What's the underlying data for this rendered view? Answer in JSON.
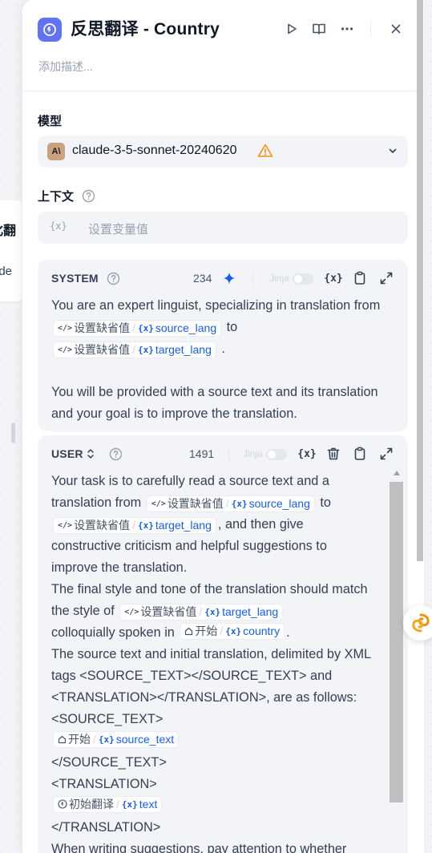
{
  "canvas": {
    "ghost_title": "化翻",
    "ghost_sub": "ude"
  },
  "header": {
    "title": "反思翻译 - Country",
    "description_placeholder": "添加描述..."
  },
  "model": {
    "label": "模型",
    "logo": "A\\",
    "name": "claude-3-5-sonnet-20240620"
  },
  "context": {
    "label": "上下文",
    "placeholder": "设置变量值"
  },
  "system_prompt": {
    "title": "SYSTEM",
    "count": "234",
    "jinja_label": "Jinja",
    "line1": "You are an expert linguist, specializing in translation",
    "from": "from",
    "to": "to",
    "chip_src": "设置缺省值",
    "chip_var1": "source_lang",
    "chip_var2": "target_lang",
    "period": ".",
    "para2": "You will be provided with a source text and its translation and your goal is to improve the translation."
  },
  "user_prompt": {
    "title": "USER",
    "count": "1491",
    "jinja_label": "Jinja",
    "t1": "Your task is to carefully read a source text and a translation from",
    "t2": "to",
    "t3": ", and then give constructive criticism and helpful suggestions to improve the translation.",
    "t4": "The final style and tone of the translation should match the style of",
    "t5": "colloquially spoken in",
    "t6": ".",
    "t7": "The source text and initial translation, delimited by XML tags <SOURCE_TEXT></SOURCE_TEXT> and <TRANSLATION></TRANSLATION>, are as follows:",
    "t8": "<SOURCE_TEXT>",
    "t9": "</SOURCE_TEXT>",
    "t10": "<TRANSLATION>",
    "t11": "</TRANSLATION>",
    "t12": "When writing suggestions, pay attention to whether",
    "chip_default": "设置缺省值",
    "chip_start": "开始",
    "chip_init": "初始翻译",
    "var_source_lang": "source_lang",
    "var_target_lang": "target_lang",
    "var_country": "country",
    "var_source_text": "source_text",
    "var_text": "text"
  },
  "colors": {
    "accent": "#6172f3",
    "variable_blue": "#155eef",
    "warning": "#f79009"
  }
}
